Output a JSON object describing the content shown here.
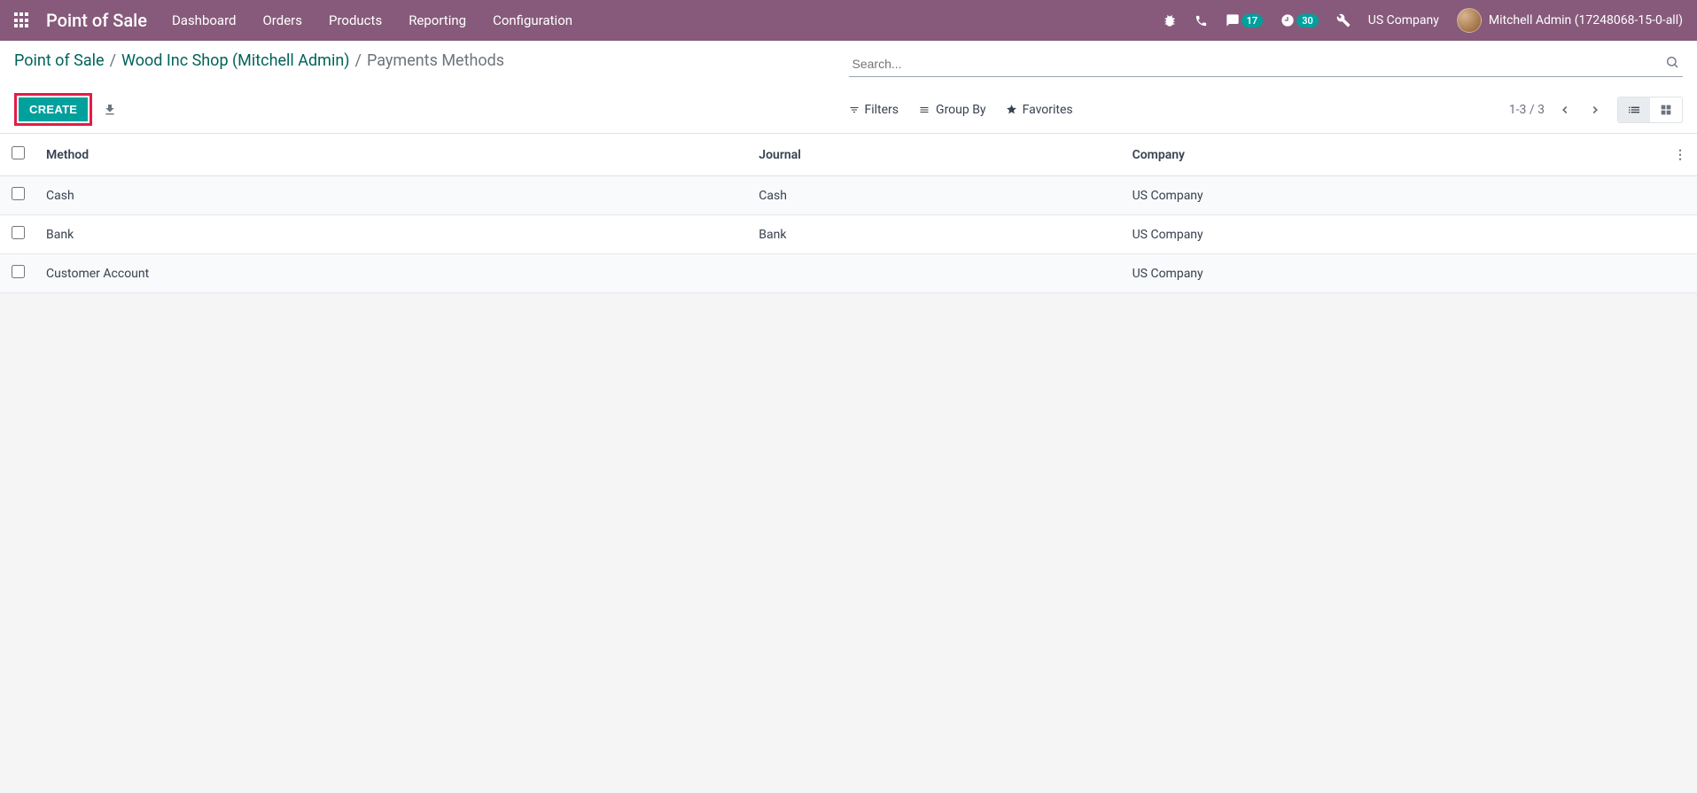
{
  "navbar": {
    "brand": "Point of Sale",
    "menu": [
      "Dashboard",
      "Orders",
      "Products",
      "Reporting",
      "Configuration"
    ],
    "messages_badge": "17",
    "activities_badge": "30",
    "company": "US Company",
    "user": "Mitchell Admin (17248068-15-0-all)"
  },
  "breadcrumb": {
    "items": [
      "Point of Sale",
      "Wood Inc Shop (Mitchell Admin)"
    ],
    "current": "Payments Methods"
  },
  "buttons": {
    "create": "CREATE"
  },
  "search": {
    "placeholder": "Search..."
  },
  "toolbar": {
    "filters": "Filters",
    "groupby": "Group By",
    "favorites": "Favorites"
  },
  "pager": {
    "range": "1-3",
    "sep": "/",
    "total": "3"
  },
  "table": {
    "headers": {
      "method": "Method",
      "journal": "Journal",
      "company": "Company"
    },
    "rows": [
      {
        "method": "Cash",
        "journal": "Cash",
        "company": "US Company"
      },
      {
        "method": "Bank",
        "journal": "Bank",
        "company": "US Company"
      },
      {
        "method": "Customer Account",
        "journal": "",
        "company": "US Company"
      }
    ]
  }
}
